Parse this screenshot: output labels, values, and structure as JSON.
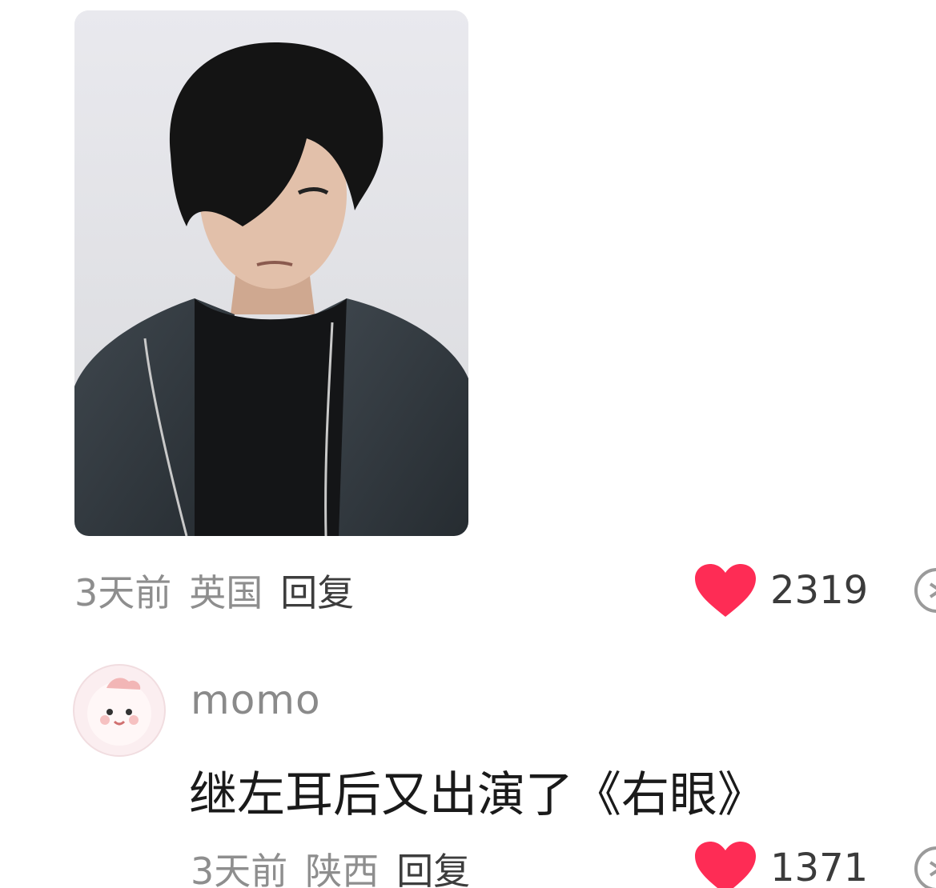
{
  "comment1": {
    "time": "3天前",
    "location": "英国",
    "reply_label": "回复",
    "likes": "2319",
    "like_color": "#fe2c55"
  },
  "comment2": {
    "username": "momo",
    "text": "继左耳后又出演了《右眼》",
    "time": "3天前",
    "location": "陕西",
    "reply_label": "回复",
    "likes": "1371",
    "like_color": "#fe2c55"
  },
  "icons": {
    "like": "heart-icon",
    "more": "more-circle-icon"
  }
}
